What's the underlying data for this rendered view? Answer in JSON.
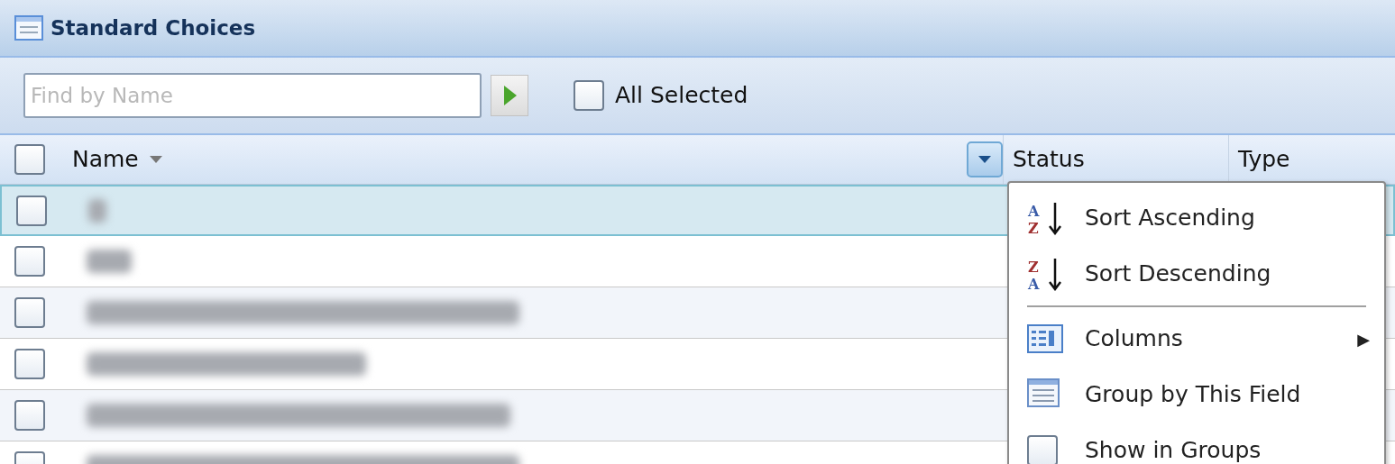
{
  "window": {
    "title": "Standard Choices"
  },
  "toolbar": {
    "search": {
      "placeholder": "Find by Name"
    },
    "all_selected": {
      "label": "All Selected",
      "checked": false
    }
  },
  "table": {
    "header_checked": false,
    "columns": [
      {
        "label": "Name",
        "sorted": true,
        "menu_open": true
      },
      {
        "label": "Status",
        "sorted": false,
        "menu_open": false
      },
      {
        "label": "Type",
        "sorted": false,
        "menu_open": false
      }
    ],
    "rows": [
      {
        "selected": true,
        "checked": false
      },
      {
        "selected": false,
        "checked": false
      },
      {
        "selected": false,
        "checked": false
      },
      {
        "selected": false,
        "checked": false
      },
      {
        "selected": false,
        "checked": false
      },
      {
        "selected": false,
        "checked": false
      }
    ]
  },
  "column_menu": {
    "items": [
      {
        "kind": "sort-asc",
        "label": "Sort Ascending",
        "icon_letters": [
          "A",
          "Z"
        ]
      },
      {
        "kind": "sort-desc",
        "label": "Sort Descending",
        "icon_letters": [
          "Z",
          "A"
        ]
      },
      {
        "kind": "separator"
      },
      {
        "kind": "columns",
        "label": "Columns",
        "submenu_arrow": "▶"
      },
      {
        "kind": "group",
        "label": "Group by This Field"
      },
      {
        "kind": "checkbox",
        "label": "Show in Groups",
        "checked": false
      }
    ]
  }
}
